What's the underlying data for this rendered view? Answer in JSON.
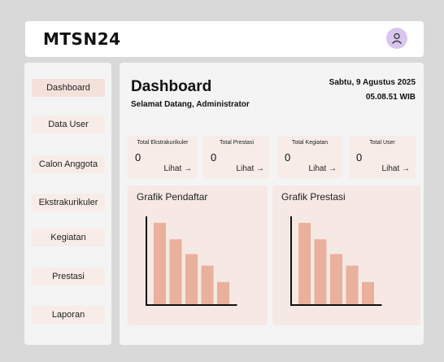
{
  "header": {
    "brand": "MTSN24",
    "avatar_icon": "user-icon",
    "avatar_color": "#d9c6ee"
  },
  "sidebar": {
    "items": [
      {
        "label": "Dashboard",
        "active": true
      },
      {
        "label": "Data User"
      },
      {
        "label": "Calon Anggota"
      },
      {
        "label": "Ekstrakurikuler"
      },
      {
        "label": "Kegiatan"
      },
      {
        "label": "Prestasi"
      },
      {
        "label": "Laporan"
      }
    ]
  },
  "main": {
    "title": "Dashboard",
    "welcome": "Selamat Datang, Administrator",
    "date": "Sabtu, 9 Agustus 2025",
    "time": "05.08.51 WIB",
    "cards": [
      {
        "label": "Total Ekstrakurikuler",
        "value": "0",
        "link": "Lihat →"
      },
      {
        "label": "Total Prestasi",
        "value": "0",
        "link": "Lihat →"
      },
      {
        "label": "Total Kegiatan",
        "value": "0",
        "link": "Lihat →"
      },
      {
        "label": "Total User",
        "value": "0",
        "link": "Lihat →"
      }
    ]
  },
  "colors": {
    "bar": "#e9b09c",
    "axis": "#111111",
    "card_bg": "#f7ece8",
    "panel_bg": "#f6e8e4"
  },
  "chart_data": [
    {
      "type": "bar",
      "title": "Grafik Pendaftar",
      "categories": [
        "",
        "",
        "",
        "",
        ""
      ],
      "values": [
        100,
        80,
        62,
        48,
        28
      ],
      "ylim": [
        0,
        100
      ]
    },
    {
      "type": "bar",
      "title": "Grafik Prestasi",
      "categories": [
        "",
        "",
        "",
        "",
        ""
      ],
      "values": [
        100,
        80,
        62,
        48,
        28
      ],
      "ylim": [
        0,
        100
      ]
    }
  ]
}
